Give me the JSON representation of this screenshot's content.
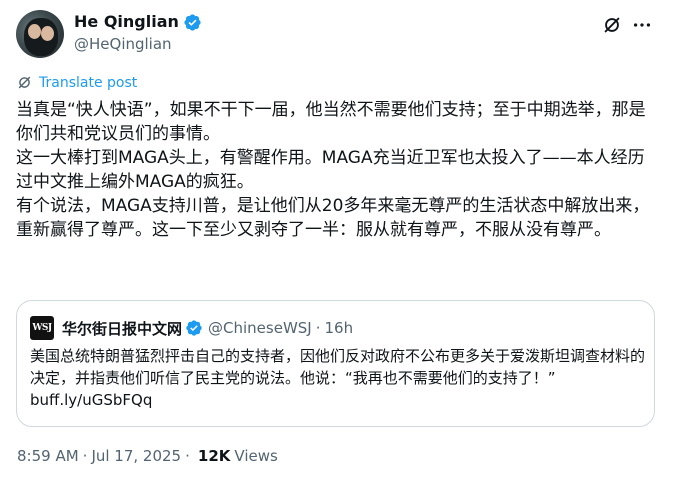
{
  "author": {
    "display_name": "He Qinglian",
    "handle": "@HeQinglian",
    "verified_icon": "verified-badge-icon",
    "verified_color": "#1d9bf0"
  },
  "actions": {
    "grok_icon": "grok-icon",
    "more_icon": "more-icon"
  },
  "translate": {
    "label": "Translate post",
    "icon": "translate-icon"
  },
  "post": {
    "paragraphs": [
      "当真是“快人快语”，如果不干下一届，他当然不需要他们支持；至于中期选举，那是你们共和党议员们的事情。",
      "这一大棒打到MAGA头上，有警醒作用。MAGA充当近卫军也太投入了——本人经历过中文推上编外MAGA的疯狂。",
      "有个说法，MAGA支持川普，是让他们从20多年来毫无尊严的生活状态中解放出来，重新赢得了尊严。这一下至少又剥夺了一半：服从就有尊严，不服从没有尊严。"
    ]
  },
  "quoted_post": {
    "avatar_text": "WSJ",
    "display_name": "华尔街日报中文网",
    "handle": "@ChineseWSJ",
    "separator": "·",
    "time": "16h",
    "text": "美国总统特朗普猛烈抨击自己的支持者，因他们反对政府不公布更多关于爱泼斯坦调查材料的决定，并指责他们听信了民主党的说法。他说：“我再也不需要他们的支持了！” buff.ly/uGSbFQq"
  },
  "meta": {
    "time": "8:59 AM",
    "separator": "·",
    "date": "Jul 17, 2025",
    "separator2": "·",
    "views_count": "12K",
    "views_label": "Views"
  }
}
